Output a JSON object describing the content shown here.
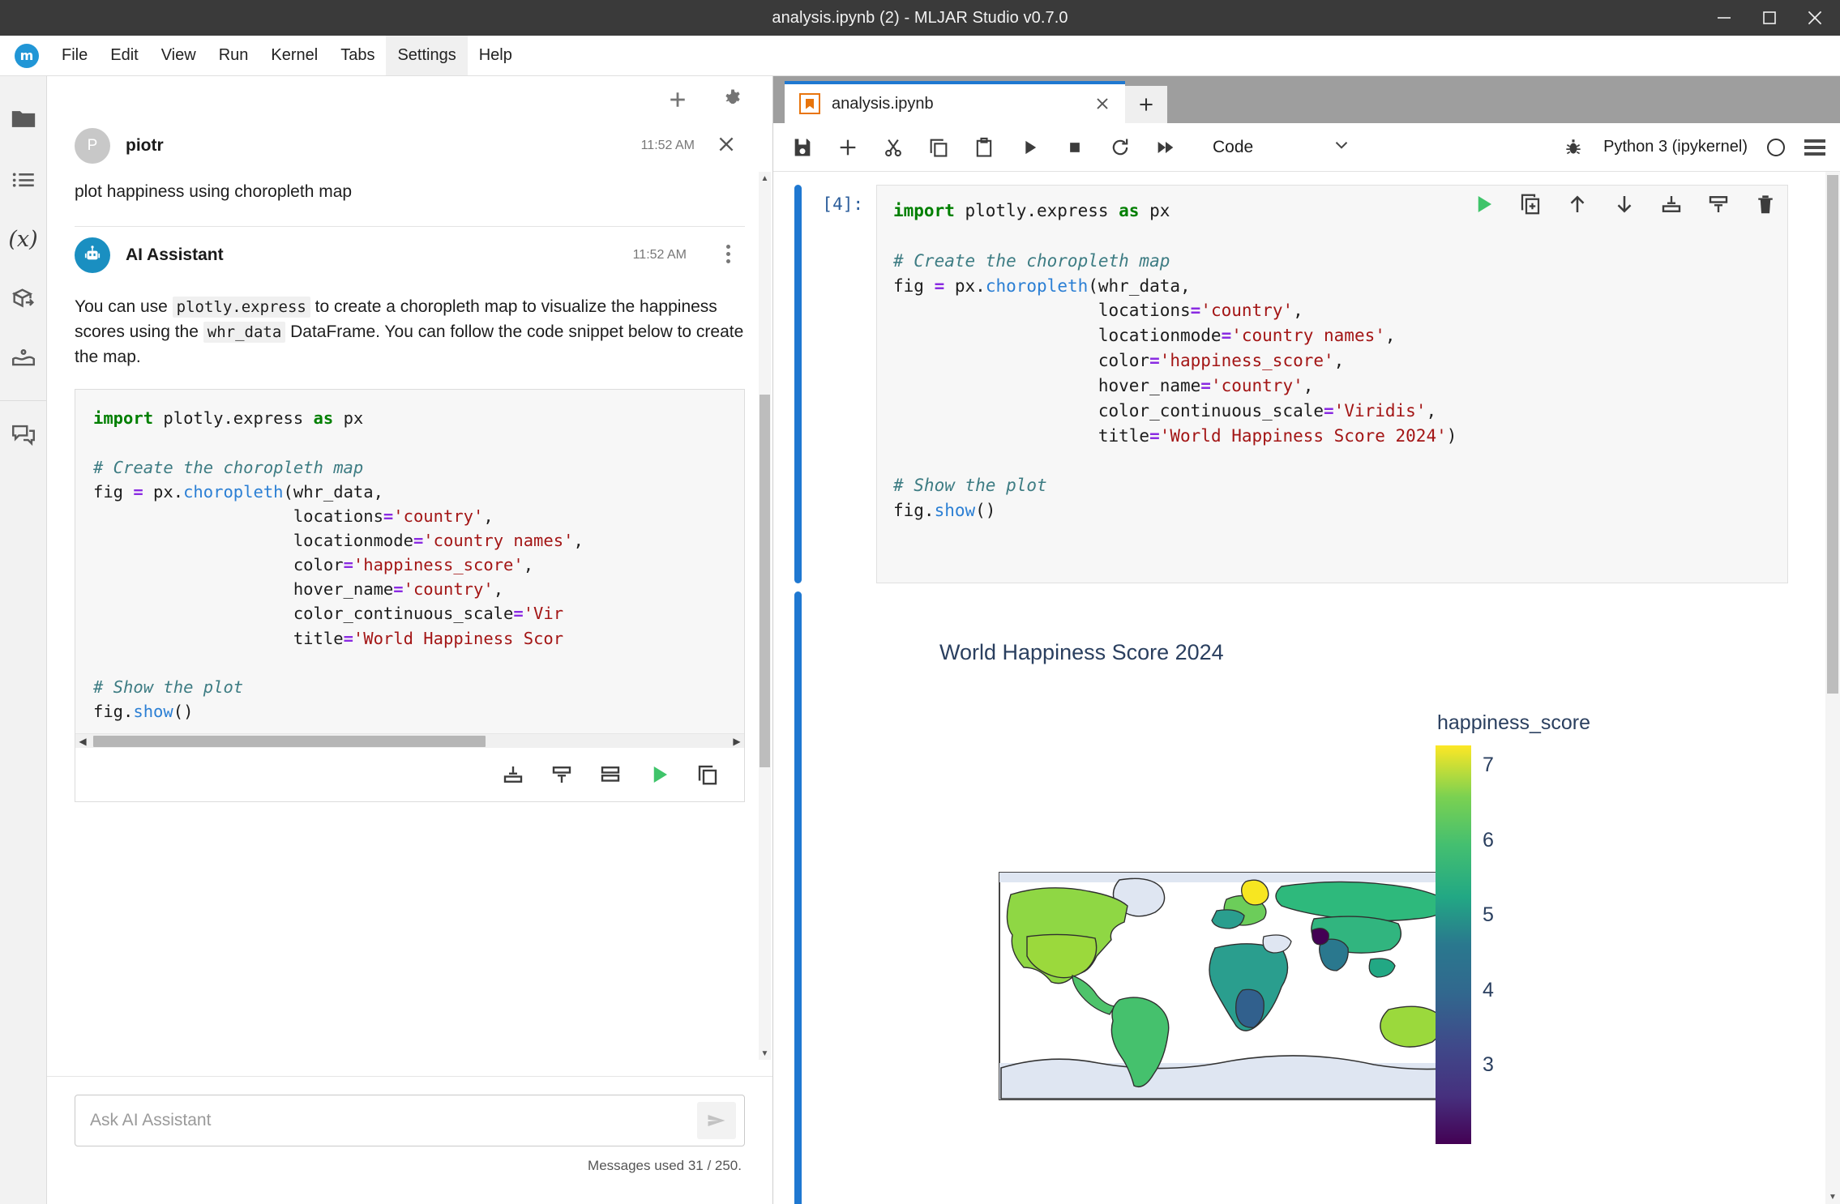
{
  "window": {
    "title": "analysis.ipynb (2) - MLJAR Studio v0.7.0",
    "minimize_icon": "minimize-icon",
    "maximize_icon": "maximize-icon",
    "close_icon": "close-icon"
  },
  "menubar": {
    "logo": "m",
    "items": [
      "File",
      "Edit",
      "View",
      "Run",
      "Kernel",
      "Tabs",
      "Settings",
      "Help"
    ],
    "active": "Settings"
  },
  "sidebar": {
    "items": [
      {
        "icon": "folder-icon",
        "name": "file-browser"
      },
      {
        "icon": "list-icon",
        "name": "running-terminals"
      },
      {
        "icon": "variables-icon",
        "name": "variable-inspector"
      },
      {
        "icon": "package-icon",
        "name": "extensions"
      },
      {
        "icon": "kernel-icon",
        "name": "packages"
      },
      {
        "icon": "chat-icon",
        "name": "ai-chat"
      }
    ]
  },
  "chat": {
    "header": {
      "new_chat_icon": "plus-icon",
      "settings_icon": "gear-icon"
    },
    "messages": [
      {
        "author": "piotr",
        "avatar_initial": "P",
        "time": "11:52 AM",
        "text": "plot happiness using choropleth map"
      },
      {
        "author": "AI Assistant",
        "avatar_icon": "robot-icon",
        "time": "11:52 AM",
        "text_parts": [
          {
            "type": "text",
            "value": "You can use "
          },
          {
            "type": "code",
            "value": "plotly.express"
          },
          {
            "type": "text",
            "value": " to create a choropleth map to visualize the happiness scores using the "
          },
          {
            "type": "code",
            "value": "whr_data"
          },
          {
            "type": "text",
            "value": " DataFrame. You can follow the code snippet below to create the map."
          }
        ]
      }
    ],
    "code_snippet_lines": [
      [
        {
          "t": "k",
          "v": "import"
        },
        {
          "t": "n",
          "v": " plotly.express "
        },
        {
          "t": "k",
          "v": "as"
        },
        {
          "t": "n",
          "v": " px"
        }
      ],
      [],
      [
        {
          "t": "c",
          "v": "# Create the choropleth map"
        }
      ],
      [
        {
          "t": "n",
          "v": "fig "
        },
        {
          "t": "o",
          "v": "="
        },
        {
          "t": "n",
          "v": " px."
        },
        {
          "t": "f",
          "v": "choropleth"
        },
        {
          "t": "n",
          "v": "(whr_data,"
        }
      ],
      [
        {
          "t": "n",
          "v": "                    locations"
        },
        {
          "t": "o",
          "v": "="
        },
        {
          "t": "s",
          "v": "'country'"
        },
        {
          "t": "n",
          "v": ","
        }
      ],
      [
        {
          "t": "n",
          "v": "                    locationmode"
        },
        {
          "t": "o",
          "v": "="
        },
        {
          "t": "s",
          "v": "'country names'"
        },
        {
          "t": "n",
          "v": ","
        }
      ],
      [
        {
          "t": "n",
          "v": "                    color"
        },
        {
          "t": "o",
          "v": "="
        },
        {
          "t": "s",
          "v": "'happiness_score'"
        },
        {
          "t": "n",
          "v": ","
        }
      ],
      [
        {
          "t": "n",
          "v": "                    hover_name"
        },
        {
          "t": "o",
          "v": "="
        },
        {
          "t": "s",
          "v": "'country'"
        },
        {
          "t": "n",
          "v": ","
        }
      ],
      [
        {
          "t": "n",
          "v": "                    color_continuous_scale"
        },
        {
          "t": "o",
          "v": "="
        },
        {
          "t": "s",
          "v": "'Vir"
        }
      ],
      [
        {
          "t": "n",
          "v": "                    title"
        },
        {
          "t": "o",
          "v": "="
        },
        {
          "t": "s",
          "v": "'World Happiness Scor"
        }
      ],
      [],
      [
        {
          "t": "c",
          "v": "# Show the plot"
        }
      ],
      [
        {
          "t": "n",
          "v": "fig."
        },
        {
          "t": "f",
          "v": "show"
        },
        {
          "t": "n",
          "v": "()"
        }
      ]
    ],
    "code_actions": [
      {
        "icon": "insert-above-icon",
        "name": "insert-cell-above"
      },
      {
        "icon": "insert-below-icon",
        "name": "insert-cell-below"
      },
      {
        "icon": "replace-cell-icon",
        "name": "replace-cell"
      },
      {
        "icon": "run-icon",
        "name": "run-code"
      },
      {
        "icon": "copy-icon",
        "name": "copy-code"
      }
    ],
    "input": {
      "placeholder": "Ask AI Assistant",
      "value": "",
      "send_icon": "send-icon"
    },
    "messages_used": "Messages used 31 / 250."
  },
  "notebook": {
    "tab": {
      "label": "analysis.ipynb",
      "icon": "notebook-icon",
      "close_icon": "close-icon",
      "add_tab_icon": "plus-icon"
    },
    "toolbar": {
      "icons": [
        {
          "icon": "save-icon",
          "name": "save-notebook"
        },
        {
          "icon": "plus-icon",
          "name": "insert-cell"
        },
        {
          "icon": "cut-icon",
          "name": "cut-cell"
        },
        {
          "icon": "copy-icon",
          "name": "copy-cell"
        },
        {
          "icon": "paste-icon",
          "name": "paste-cell"
        },
        {
          "icon": "run-icon",
          "name": "run-cell"
        },
        {
          "icon": "stop-icon",
          "name": "interrupt-kernel"
        },
        {
          "icon": "restart-icon",
          "name": "restart-kernel"
        },
        {
          "icon": "fast-forward-icon",
          "name": "restart-and-run-all"
        }
      ],
      "cell_type": "Code",
      "cell_type_chevron": "chevron-down-icon",
      "debugger_icon": "bug-icon",
      "kernel_name": "Python 3 (ipykernel)",
      "kernel_status": "idle-circle-icon",
      "menu_icon": "hamburger-icon"
    },
    "cell": {
      "prompt": "[4]:",
      "code_lines": [
        [
          {
            "t": "k",
            "v": "import"
          },
          {
            "t": "n",
            "v": " plotly.express "
          },
          {
            "t": "k",
            "v": "as"
          },
          {
            "t": "n",
            "v": " px"
          }
        ],
        [],
        [
          {
            "t": "c",
            "v": "# Create the choropleth map"
          }
        ],
        [
          {
            "t": "n",
            "v": "fig "
          },
          {
            "t": "o",
            "v": "="
          },
          {
            "t": "n",
            "v": " px."
          },
          {
            "t": "f",
            "v": "choropleth"
          },
          {
            "t": "n",
            "v": "(whr_data,"
          }
        ],
        [
          {
            "t": "n",
            "v": "                    locations"
          },
          {
            "t": "o",
            "v": "="
          },
          {
            "t": "s",
            "v": "'country'"
          },
          {
            "t": "n",
            "v": ","
          }
        ],
        [
          {
            "t": "n",
            "v": "                    locationmode"
          },
          {
            "t": "o",
            "v": "="
          },
          {
            "t": "s",
            "v": "'country names'"
          },
          {
            "t": "n",
            "v": ","
          }
        ],
        [
          {
            "t": "n",
            "v": "                    color"
          },
          {
            "t": "o",
            "v": "="
          },
          {
            "t": "s",
            "v": "'happiness_score'"
          },
          {
            "t": "n",
            "v": ","
          }
        ],
        [
          {
            "t": "n",
            "v": "                    hover_name"
          },
          {
            "t": "o",
            "v": "="
          },
          {
            "t": "s",
            "v": "'country'"
          },
          {
            "t": "n",
            "v": ","
          }
        ],
        [
          {
            "t": "n",
            "v": "                    color_continuous_scale"
          },
          {
            "t": "o",
            "v": "="
          },
          {
            "t": "s",
            "v": "'Viridis'"
          },
          {
            "t": "n",
            "v": ","
          }
        ],
        [
          {
            "t": "n",
            "v": "                    title"
          },
          {
            "t": "o",
            "v": "="
          },
          {
            "t": "s",
            "v": "'World Happiness Score 2024'"
          },
          {
            "t": "n",
            "v": ")"
          }
        ],
        [],
        [
          {
            "t": "c",
            "v": "# Show the plot"
          }
        ],
        [
          {
            "t": "n",
            "v": "fig."
          },
          {
            "t": "f",
            "v": "show"
          },
          {
            "t": "n",
            "v": "()"
          }
        ]
      ],
      "actions": [
        {
          "icon": "run-icon",
          "name": "run-cell"
        },
        {
          "icon": "duplicate-icon",
          "name": "duplicate-cell"
        },
        {
          "icon": "arrow-up-icon",
          "name": "move-cell-up"
        },
        {
          "icon": "arrow-down-icon",
          "name": "move-cell-down"
        },
        {
          "icon": "insert-above-icon",
          "name": "insert-cell-above"
        },
        {
          "icon": "insert-below-icon",
          "name": "insert-cell-below"
        },
        {
          "icon": "trash-icon",
          "name": "delete-cell"
        }
      ]
    }
  },
  "chart_data": {
    "type": "choropleth",
    "title": "World Happiness Score 2024",
    "colorbar_title": "happiness_score",
    "colorscale": "Viridis",
    "colorbar_ticks": [
      "7",
      "6",
      "5",
      "4",
      "3"
    ],
    "zmin": 2.5,
    "zmax": 7.8,
    "ocean_color": "#ffffff",
    "land_missing_color": "#dfe6f2",
    "title_color": "#2a3f5f",
    "regions": [
      {
        "name": "Canada",
        "value": 7.0,
        "color": "#8fd744"
      },
      {
        "name": "United States",
        "value": 6.8,
        "color": "#9bd93c"
      },
      {
        "name": "Greenland",
        "value": null,
        "color": "#dfe6f2"
      },
      {
        "name": "Mexico",
        "value": 6.4,
        "color": "#4ec36b"
      },
      {
        "name": "Brazil",
        "value": 6.3,
        "color": "#45c16d"
      },
      {
        "name": "Argentina",
        "value": 6.2,
        "color": "#40bf72"
      },
      {
        "name": "Finland",
        "value": 7.7,
        "color": "#f7e621"
      },
      {
        "name": "Denmark",
        "value": 7.6,
        "color": "#f1e51f"
      },
      {
        "name": "Norway",
        "value": 7.3,
        "color": "#d8e219"
      },
      {
        "name": "Sweden",
        "value": 7.3,
        "color": "#dce319"
      },
      {
        "name": "Iceland",
        "value": 7.5,
        "color": "#e8e419"
      },
      {
        "name": "Russia",
        "value": 6.0,
        "color": "#2eb97c"
      },
      {
        "name": "China",
        "value": 5.9,
        "color": "#31b57f"
      },
      {
        "name": "India",
        "value": 4.1,
        "color": "#2a788e"
      },
      {
        "name": "Afghanistan",
        "value": 1.7,
        "color": "#440154"
      },
      {
        "name": "Australia",
        "value": 7.0,
        "color": "#8bd646"
      },
      {
        "name": "Saudi Arabia",
        "value": 6.6,
        "color": "#6ccd5a"
      },
      {
        "name": "South Africa",
        "value": 5.4,
        "color": "#21a585"
      },
      {
        "name": "Congo",
        "value": 3.4,
        "color": "#35608d"
      },
      {
        "name": "Antarctica",
        "value": null,
        "color": "#dfe6f2"
      }
    ]
  }
}
